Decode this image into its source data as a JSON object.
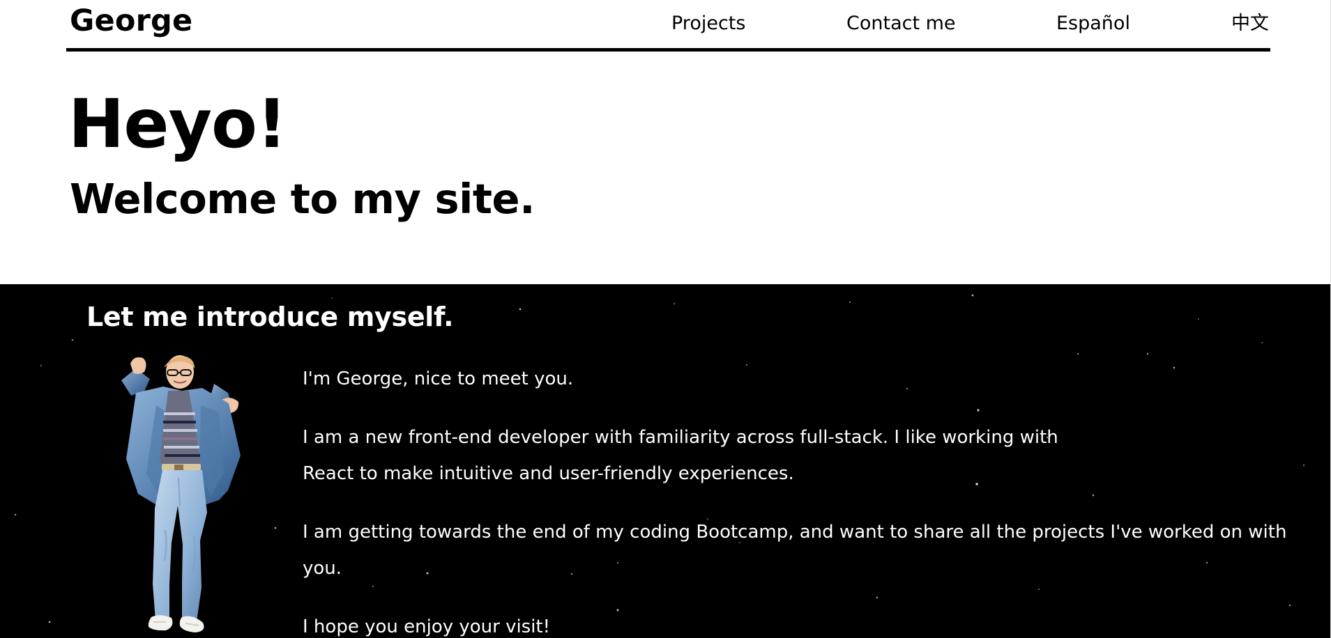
{
  "header": {
    "brand": "George",
    "nav": {
      "projects": "Projects",
      "contact": "Contact me",
      "spanish": "Español",
      "chinese": "中文"
    }
  },
  "hero": {
    "title": "Heyo!",
    "subtitle": "Welcome to my site."
  },
  "about": {
    "heading": "Let me introduce myself.",
    "paragraphs": [
      "I'm George, nice to meet you.",
      "I am a new front-end developer with familiarity across full-stack. I like working with React to make intuitive and user-friendly experiences.",
      "I am getting towards the end of my coding Bootcamp, and want to share all the projects I've worked on with you.",
      "I hope you enjoy your visit!"
    ]
  },
  "colors": {
    "text": "#000000",
    "background": "#ffffff",
    "about_background": "#000000",
    "about_text": "#ffffff"
  }
}
